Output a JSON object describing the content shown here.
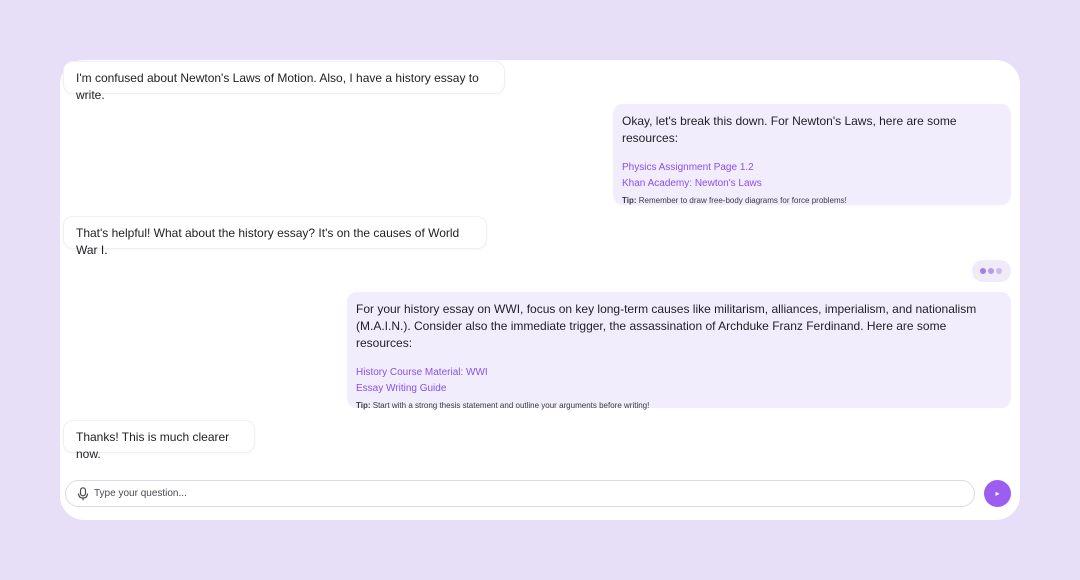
{
  "conversation": {
    "messages": [
      {
        "role": "user",
        "text": "I'm confused about Newton's Laws of Motion. Also, I have a history essay to write."
      },
      {
        "role": "assistant",
        "text": "Okay, let's break this down. For Newton's Laws, here are some resources:",
        "links": [
          "Physics Assignment Page 1.2",
          "Khan Academy: Newton's Laws"
        ],
        "tip_label": "Tip:",
        "tip_text": "Remember to draw free-body diagrams for force problems!"
      },
      {
        "role": "user",
        "text": "That's helpful! What about the history essay? It's on the causes of World War I."
      },
      {
        "role": "assistant",
        "text": "For your history essay on WWI, focus on key long-term causes like militarism, alliances, imperialism, and nationalism (M.A.I.N.). Consider also the immediate trigger, the assassination of Archduke Franz Ferdinand. Here are some resources:",
        "links": [
          "History Course Material: WWI",
          "Essay Writing Guide"
        ],
        "tip_label": "Tip:",
        "tip_text": "Start with a strong thesis statement and outline your arguments before writing!"
      },
      {
        "role": "user",
        "text": "Thanks! This is much clearer now."
      }
    ]
  },
  "composer": {
    "placeholder": "Type your question...",
    "mic_icon": "microphone-icon",
    "send_icon": "send-arrow-icon",
    "send_glyph": "▸"
  },
  "colors": {
    "background": "#e7def7",
    "card": "#ffffff",
    "assistant_bubble": "#f1edfc",
    "accent": "#9b5ef0",
    "link": "#8b50e9"
  }
}
